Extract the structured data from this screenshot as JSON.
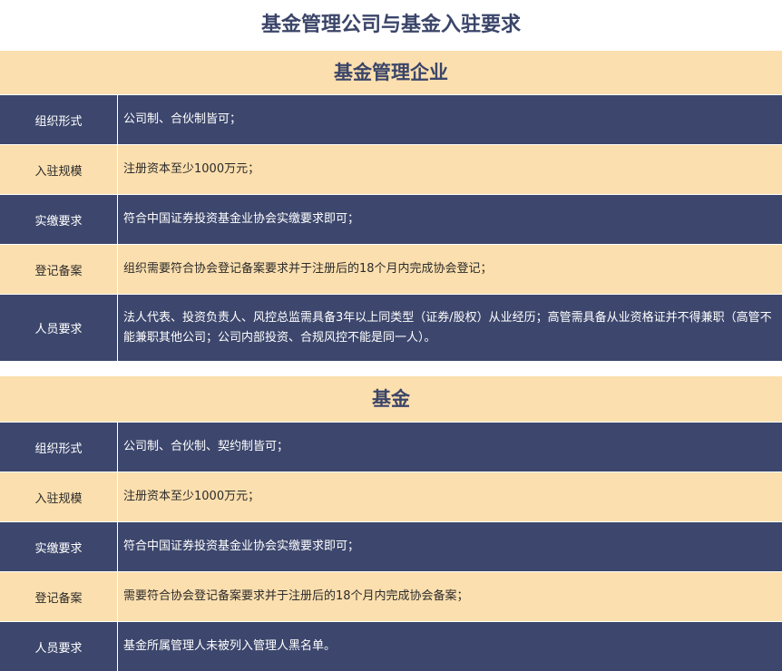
{
  "page_title": "基金管理公司与基金入驻要求",
  "sections": [
    {
      "title": "基金管理企业",
      "rows": [
        {
          "label": "组织形式",
          "value": "公司制、合伙制皆可；"
        },
        {
          "label": "入驻规模",
          "value": "注册资本至少1000万元；"
        },
        {
          "label": "实缴要求",
          "value": "符合中国证券投资基金业协会实缴要求即可；"
        },
        {
          "label": "登记备案",
          "value": "组织需要符合协会登记备案要求并于注册后的18个月内完成协会登记；"
        },
        {
          "label": "人员要求",
          "value": "法人代表、投资负责人、风控总监需具备3年以上同类型（证券/股权）从业经历；高管需具备从业资格证并不得兼职（高管不能兼职其他公司；公司内部投资、合规风控不能是同一人）。"
        }
      ]
    },
    {
      "title": "基金",
      "rows": [
        {
          "label": "组织形式",
          "value": "公司制、合伙制、契约制皆可；"
        },
        {
          "label": "入驻规模",
          "value": "注册资本至少1000万元；"
        },
        {
          "label": "实缴要求",
          "value": "符合中国证券投资基金业协会实缴要求即可；"
        },
        {
          "label": "登记备案",
          "value": "需要符合协会登记备案要求并于注册后的18个月内完成协会备案；"
        },
        {
          "label": "人员要求",
          "value": "基金所属管理人未被列入管理人黑名单。"
        }
      ]
    }
  ]
}
